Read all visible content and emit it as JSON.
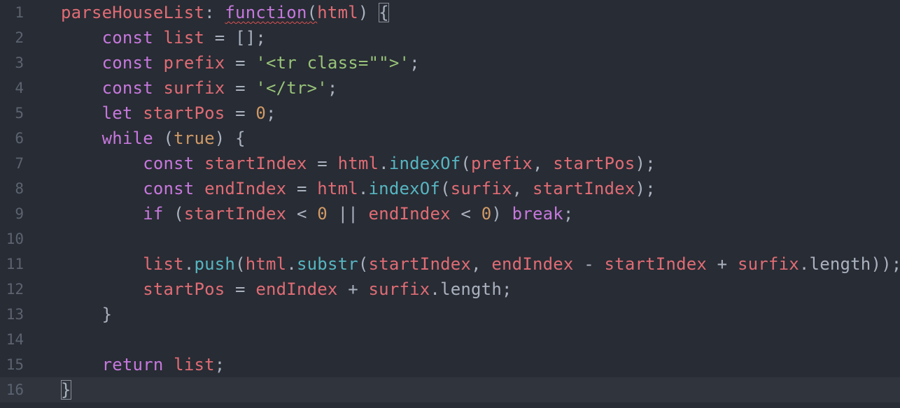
{
  "editor": {
    "theme_colors": {
      "background": "#282c34",
      "keyword": "#c678dd",
      "variable": "#e06c75",
      "string": "#98c379",
      "number": "#d19a66",
      "method": "#56b6c2",
      "line_number": "#5c6370"
    },
    "active_line": 16,
    "lines": [
      {
        "n": "1",
        "tokens": [
          {
            "t": "parseHouseList",
            "c": "t-var"
          },
          {
            "t": ": ",
            "c": "t-punc"
          },
          {
            "t": "function",
            "c": "t-kw squiggle"
          },
          {
            "t": "(",
            "c": "t-punc squiggle"
          },
          {
            "t": "html",
            "c": "t-var"
          },
          {
            "t": ") ",
            "c": "t-punc"
          },
          {
            "t": "{",
            "c": "t-punc bracket-match"
          }
        ]
      },
      {
        "n": "2",
        "tokens": [
          {
            "t": "    ",
            "c": ""
          },
          {
            "t": "const",
            "c": "t-kw"
          },
          {
            "t": " ",
            "c": ""
          },
          {
            "t": "list",
            "c": "t-var"
          },
          {
            "t": " = [];",
            "c": "t-punc"
          }
        ]
      },
      {
        "n": "3",
        "tokens": [
          {
            "t": "    ",
            "c": ""
          },
          {
            "t": "const",
            "c": "t-kw"
          },
          {
            "t": " ",
            "c": ""
          },
          {
            "t": "prefix",
            "c": "t-var"
          },
          {
            "t": " = ",
            "c": "t-punc"
          },
          {
            "t": "'<tr class=\"\">'",
            "c": "t-str"
          },
          {
            "t": ";",
            "c": "t-punc"
          }
        ]
      },
      {
        "n": "4",
        "tokens": [
          {
            "t": "    ",
            "c": ""
          },
          {
            "t": "const",
            "c": "t-kw"
          },
          {
            "t": " ",
            "c": ""
          },
          {
            "t": "surfix",
            "c": "t-var"
          },
          {
            "t": " = ",
            "c": "t-punc"
          },
          {
            "t": "'</tr>'",
            "c": "t-str"
          },
          {
            "t": ";",
            "c": "t-punc"
          }
        ]
      },
      {
        "n": "5",
        "tokens": [
          {
            "t": "    ",
            "c": ""
          },
          {
            "t": "let",
            "c": "t-kw"
          },
          {
            "t": " ",
            "c": ""
          },
          {
            "t": "startPos",
            "c": "t-var"
          },
          {
            "t": " = ",
            "c": "t-punc"
          },
          {
            "t": "0",
            "c": "t-num"
          },
          {
            "t": ";",
            "c": "t-punc"
          }
        ]
      },
      {
        "n": "6",
        "tokens": [
          {
            "t": "    ",
            "c": ""
          },
          {
            "t": "while",
            "c": "t-kw"
          },
          {
            "t": " (",
            "c": "t-punc"
          },
          {
            "t": "true",
            "c": "t-num"
          },
          {
            "t": ") {",
            "c": "t-punc"
          }
        ]
      },
      {
        "n": "7",
        "tokens": [
          {
            "t": "        ",
            "c": ""
          },
          {
            "t": "const",
            "c": "t-kw"
          },
          {
            "t": " ",
            "c": ""
          },
          {
            "t": "startIndex",
            "c": "t-var"
          },
          {
            "t": " = ",
            "c": "t-punc"
          },
          {
            "t": "html",
            "c": "t-var"
          },
          {
            "t": ".",
            "c": "t-punc"
          },
          {
            "t": "indexOf",
            "c": "t-meth"
          },
          {
            "t": "(",
            "c": "t-punc"
          },
          {
            "t": "prefix",
            "c": "t-var"
          },
          {
            "t": ", ",
            "c": "t-punc"
          },
          {
            "t": "startPos",
            "c": "t-var"
          },
          {
            "t": ");",
            "c": "t-punc"
          }
        ]
      },
      {
        "n": "8",
        "tokens": [
          {
            "t": "        ",
            "c": ""
          },
          {
            "t": "const",
            "c": "t-kw"
          },
          {
            "t": " ",
            "c": ""
          },
          {
            "t": "endIndex",
            "c": "t-var"
          },
          {
            "t": " = ",
            "c": "t-punc"
          },
          {
            "t": "html",
            "c": "t-var"
          },
          {
            "t": ".",
            "c": "t-punc"
          },
          {
            "t": "indexOf",
            "c": "t-meth"
          },
          {
            "t": "(",
            "c": "t-punc"
          },
          {
            "t": "surfix",
            "c": "t-var"
          },
          {
            "t": ", ",
            "c": "t-punc"
          },
          {
            "t": "startIndex",
            "c": "t-var"
          },
          {
            "t": ");",
            "c": "t-punc"
          }
        ]
      },
      {
        "n": "9",
        "tokens": [
          {
            "t": "        ",
            "c": ""
          },
          {
            "t": "if",
            "c": "t-kw"
          },
          {
            "t": " (",
            "c": "t-punc"
          },
          {
            "t": "startIndex",
            "c": "t-var"
          },
          {
            "t": " < ",
            "c": "t-punc"
          },
          {
            "t": "0",
            "c": "t-num"
          },
          {
            "t": " || ",
            "c": "t-punc"
          },
          {
            "t": "endIndex",
            "c": "t-var"
          },
          {
            "t": " < ",
            "c": "t-punc"
          },
          {
            "t": "0",
            "c": "t-num"
          },
          {
            "t": ") ",
            "c": "t-punc"
          },
          {
            "t": "break",
            "c": "t-kw"
          },
          {
            "t": ";",
            "c": "t-punc"
          }
        ]
      },
      {
        "n": "10",
        "tokens": []
      },
      {
        "n": "11",
        "tokens": [
          {
            "t": "        ",
            "c": ""
          },
          {
            "t": "list",
            "c": "t-var"
          },
          {
            "t": ".",
            "c": "t-punc"
          },
          {
            "t": "push",
            "c": "t-meth"
          },
          {
            "t": "(",
            "c": "t-punc"
          },
          {
            "t": "html",
            "c": "t-var"
          },
          {
            "t": ".",
            "c": "t-punc"
          },
          {
            "t": "substr",
            "c": "t-meth"
          },
          {
            "t": "(",
            "c": "t-punc"
          },
          {
            "t": "startIndex",
            "c": "t-var"
          },
          {
            "t": ", ",
            "c": "t-punc"
          },
          {
            "t": "endIndex",
            "c": "t-var"
          },
          {
            "t": " - ",
            "c": "t-punc"
          },
          {
            "t": "startIndex",
            "c": "t-var"
          },
          {
            "t": " + ",
            "c": "t-punc"
          },
          {
            "t": "surfix",
            "c": "t-var"
          },
          {
            "t": ".",
            "c": "t-punc"
          },
          {
            "t": "length",
            "c": "t-prop"
          },
          {
            "t": "));",
            "c": "t-punc"
          }
        ]
      },
      {
        "n": "12",
        "tokens": [
          {
            "t": "        ",
            "c": ""
          },
          {
            "t": "startPos",
            "c": "t-var"
          },
          {
            "t": " = ",
            "c": "t-punc"
          },
          {
            "t": "endIndex",
            "c": "t-var"
          },
          {
            "t": " + ",
            "c": "t-punc"
          },
          {
            "t": "surfix",
            "c": "t-var"
          },
          {
            "t": ".",
            "c": "t-punc"
          },
          {
            "t": "length",
            "c": "t-prop"
          },
          {
            "t": ";",
            "c": "t-punc"
          }
        ]
      },
      {
        "n": "13",
        "tokens": [
          {
            "t": "    ",
            "c": ""
          },
          {
            "t": "}",
            "c": "t-punc"
          }
        ]
      },
      {
        "n": "14",
        "tokens": []
      },
      {
        "n": "15",
        "tokens": [
          {
            "t": "    ",
            "c": ""
          },
          {
            "t": "return",
            "c": "t-kw"
          },
          {
            "t": " ",
            "c": ""
          },
          {
            "t": "list",
            "c": "t-var"
          },
          {
            "t": ";",
            "c": "t-punc"
          }
        ]
      },
      {
        "n": "16",
        "tokens": [
          {
            "t": "}",
            "c": "t-punc bracket-match"
          }
        ]
      }
    ]
  }
}
